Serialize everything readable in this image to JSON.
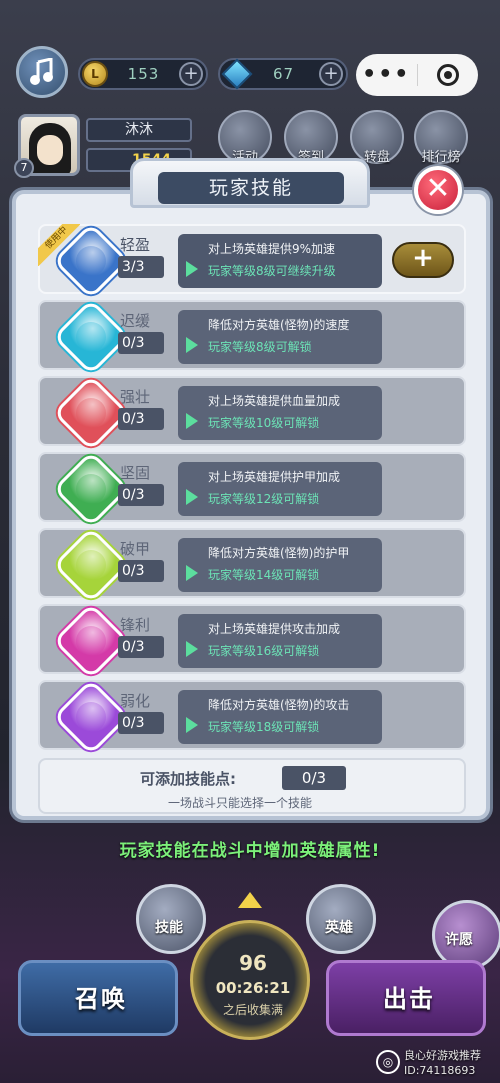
{
  "top": {
    "coins": "153",
    "gems": "67",
    "player_name": "沐沐",
    "player_level": "7",
    "power": "1544",
    "icons": [
      {
        "label": "活动"
      },
      {
        "label": "签到"
      },
      {
        "label": "转盘"
      },
      {
        "label": "排行榜"
      }
    ]
  },
  "panel": {
    "title": "玩家技能",
    "in_use_tag": "使用中",
    "upgrade_symbol": "+",
    "skills": [
      {
        "name": "轻盈",
        "level": "3/3",
        "desc": "对上场英雄提供9%加速",
        "unlock": "玩家等级8级可继续升级",
        "color": "#3a74c9"
      },
      {
        "name": "迟缓",
        "level": "0/3",
        "desc": "降低对方英雄(怪物)的速度",
        "unlock": "玩家等级8级可解锁",
        "color": "#27b6d6"
      },
      {
        "name": "强壮",
        "level": "0/3",
        "desc": "对上场英雄提供血量加成",
        "unlock": "玩家等级10级可解锁",
        "color": "#e0505a"
      },
      {
        "name": "坚固",
        "level": "0/3",
        "desc": "对上场英雄提供护甲加成",
        "unlock": "玩家等级12级可解锁",
        "color": "#3fae52"
      },
      {
        "name": "破甲",
        "level": "0/3",
        "desc": "降低对方英雄(怪物)的护甲",
        "unlock": "玩家等级14级可解锁",
        "color": "#a6d43a"
      },
      {
        "name": "锋利",
        "level": "0/3",
        "desc": "对上场英雄提供攻击加成",
        "unlock": "玩家等级16级可解锁",
        "color": "#d43aa8"
      },
      {
        "name": "弱化",
        "level": "0/3",
        "desc": "降低对方英雄(怪物)的攻击",
        "unlock": "玩家等级18级可解锁",
        "color": "#9b4ad9"
      }
    ],
    "points_label": "可添加技能点:",
    "points_value": "0/3",
    "points_note": "一场战斗只能选择一个技能"
  },
  "footer": {
    "hint": "玩家技能在战斗中增加英雄属性!",
    "btn_skill": "技能",
    "btn_hero": "英雄",
    "btn_wish": "许愿",
    "summon": "召唤",
    "attack": "出击",
    "timer_count": "96",
    "timer_time": "00:26:21",
    "timer_note": "之后收集满"
  },
  "watermark": {
    "line1": "良心好游戏推荐",
    "line2": "ID:74118693"
  }
}
